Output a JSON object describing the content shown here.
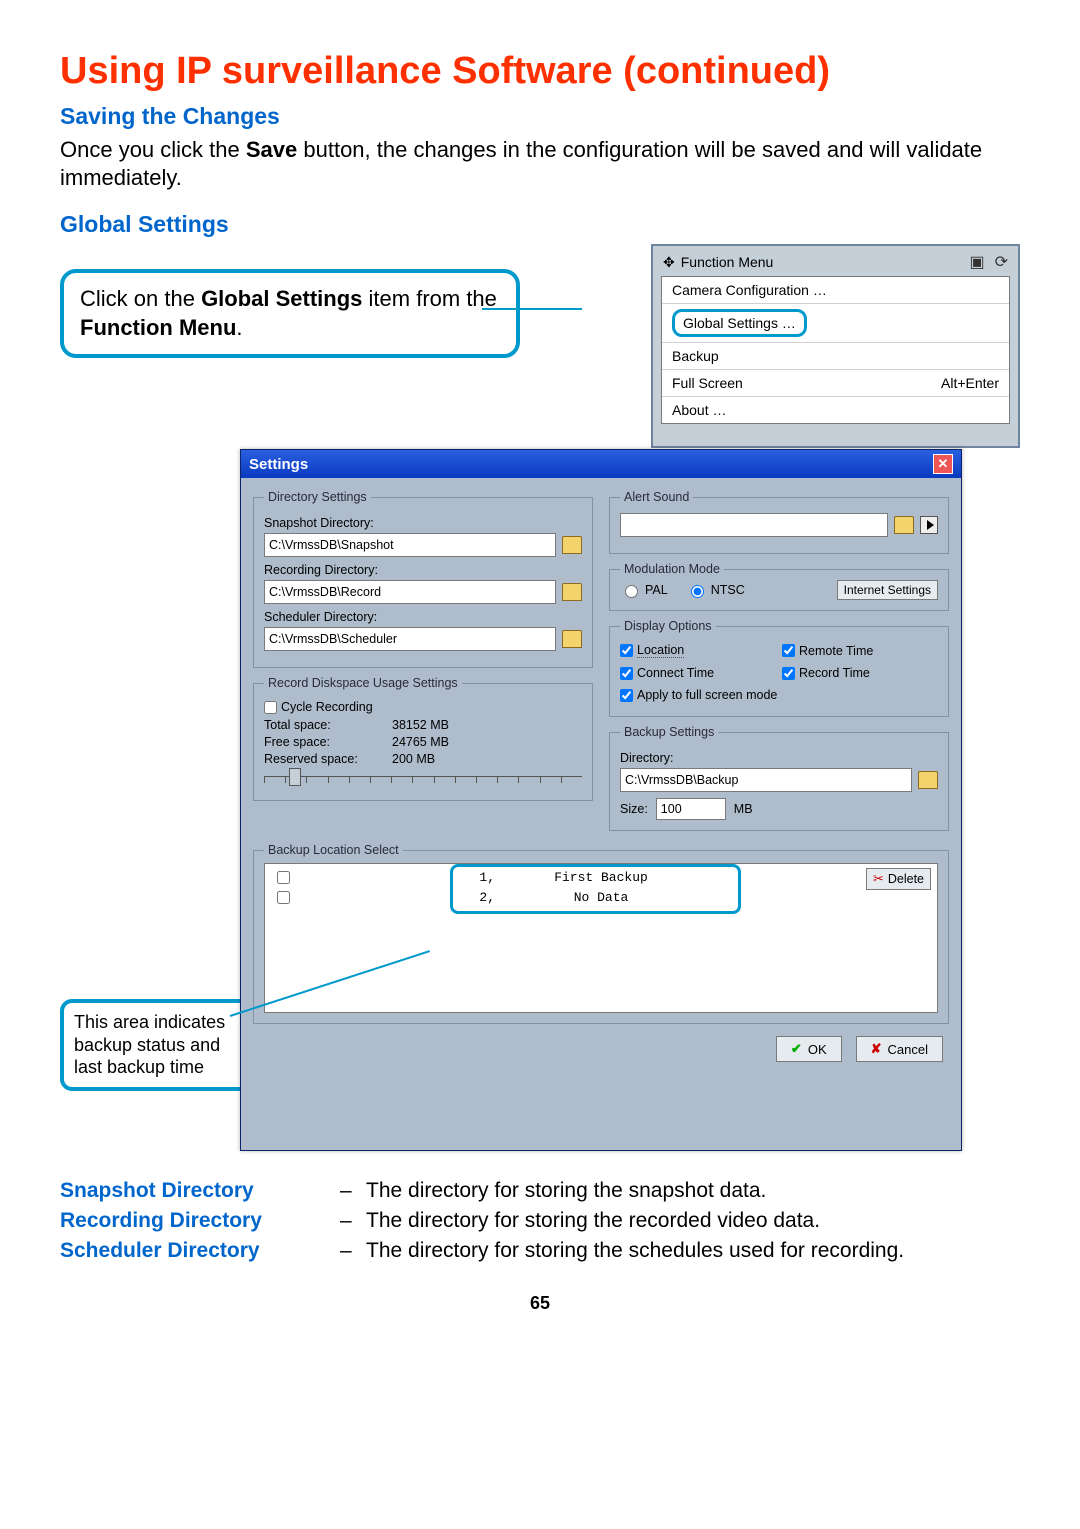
{
  "title": "Using IP surveillance Software (continued)",
  "saving_h": "Saving the Changes",
  "saving_p_pre": "Once you click the ",
  "saving_p_bold": "Save",
  "saving_p_post": " button, the changes in the configuration will be saved and will validate immediately.",
  "global_h": "Global Settings",
  "callout1_pre": "Click on the ",
  "callout1_b1": "Global Settings",
  "callout1_mid": " item from the ",
  "callout1_b2": "Function Menu",
  "callout1_end": ".",
  "callout2": "This area indicates backup status and last backup time",
  "menu": {
    "title": "Function Menu",
    "items": {
      "cam": "Camera Configuration …",
      "global": "Global Settings …",
      "backup": "Backup",
      "full": "Full Screen",
      "full_sc": "Alt+Enter",
      "about": "About …"
    }
  },
  "dlg": {
    "title": "Settings",
    "dir_legend": "Directory Settings",
    "snap_lbl": "Snapshot Directory:",
    "snap_val": "C:\\VrmssDB\\Snapshot",
    "rec_lbl": "Recording Directory:",
    "rec_val": "C:\\VrmssDB\\Record",
    "sch_lbl": "Scheduler Directory:",
    "sch_val": "C:\\VrmssDB\\Scheduler",
    "disk_legend": "Record Diskspace Usage Settings",
    "cycle": "Cycle Recording",
    "total_k": "Total space:",
    "total_v": "38152 MB",
    "free_k": "Free space:",
    "free_v": "24765 MB",
    "res_k": "Reserved space:",
    "res_v": "200 MB",
    "alert_legend": "Alert Sound",
    "mod_legend": "Modulation Mode",
    "pal": "PAL",
    "ntsc": "NTSC",
    "internet": "Internet Settings",
    "disp_legend": "Display Options",
    "loc": "Location",
    "remote": "Remote Time",
    "connect": "Connect Time",
    "record": "Record Time",
    "apply": "Apply to full screen mode",
    "bset_legend": "Backup Settings",
    "bdir_lbl": "Directory:",
    "bdir_val": "C:\\VrmssDB\\Backup",
    "size_lbl": "Size:",
    "size_val": "100",
    "size_unit": "MB",
    "blist_legend": "Backup Location Select",
    "r1n": "1,",
    "r1s": "First Backup",
    "r2n": "2,",
    "r2s": "No Data",
    "delete": "Delete",
    "ok": "OK",
    "cancel": "Cancel"
  },
  "defs": {
    "snap_t": "Snapshot Directory",
    "snap_d": "The directory for storing the snapshot data.",
    "rec_t": "Recording Directory",
    "rec_d": "The directory for storing the recorded video data.",
    "sch_t": "Scheduler Directory",
    "sch_d": "The directory for storing the schedules used for recording."
  },
  "pagenum": "65",
  "dash": "–"
}
